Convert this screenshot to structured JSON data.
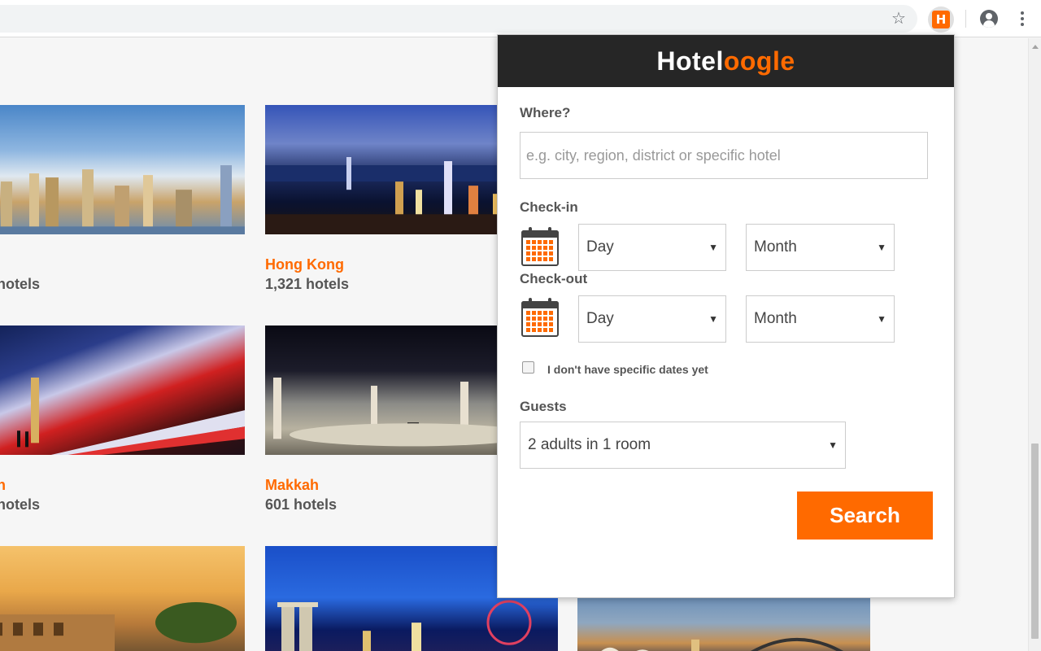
{
  "browser": {
    "star_icon": "star-icon",
    "extension_icon": "hoteloogle-extension-icon",
    "extension_letter": "H",
    "account_icon": "account-icon",
    "menu_icon": "more-vert-icon"
  },
  "page": {
    "cards": [
      {
        "name": "",
        "count": "hotels"
      },
      {
        "name": "Hong Kong",
        "count": "1,321 hotels"
      },
      {
        "name": "n",
        "count": "hotels"
      },
      {
        "name": "Makkah",
        "count": "601 hotels"
      }
    ]
  },
  "popup": {
    "brand_part1": "Hotel",
    "brand_part2": "oogle",
    "brand_color": "#ff6a00",
    "where_label": "Where?",
    "where_placeholder": "e.g. city, region, district or specific hotel",
    "where_value": "",
    "checkin_label": "Check-in",
    "checkin_day": "Day",
    "checkin_month": "Month",
    "checkout_label": "Check-out",
    "checkout_day": "Day",
    "checkout_month": "Month",
    "no_dates_label": "I don't have specific dates yet",
    "no_dates_checked": false,
    "guests_label": "Guests",
    "guests_value": "2 adults in 1 room",
    "search_label": "Search",
    "dropdown_arrow": "▼"
  }
}
